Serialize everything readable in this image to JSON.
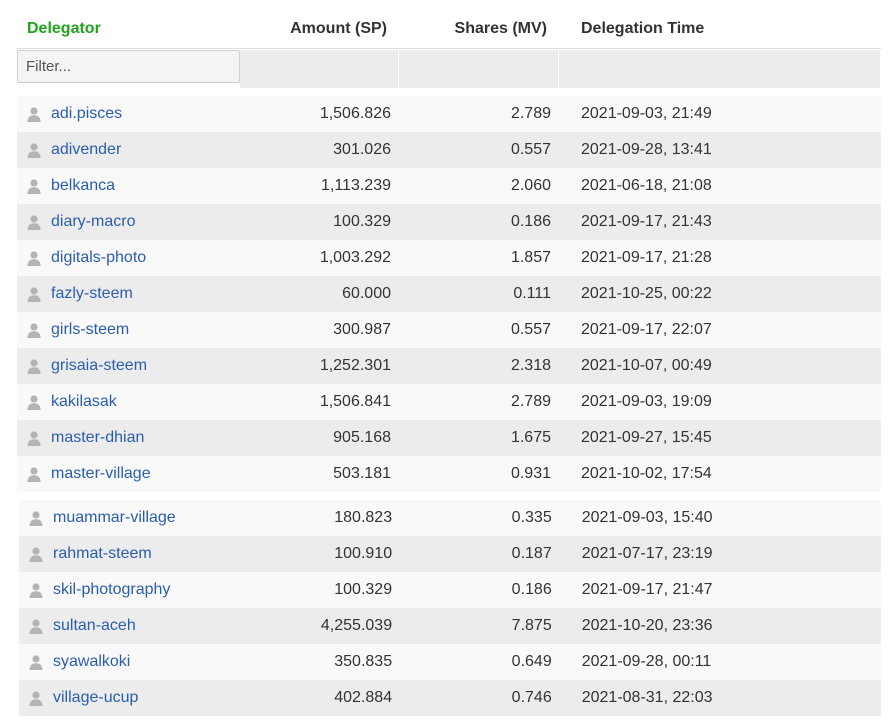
{
  "header": {
    "delegator": "Delegator",
    "amount": "Amount (SP)",
    "shares": "Shares (MV)",
    "time": "Delegation Time"
  },
  "filter": {
    "placeholder": "Filter..."
  },
  "colors": {
    "delegator_header": "#22a31f",
    "link": "#2a5db0",
    "row_light": "#f9f9f9",
    "row_dark": "#ececec"
  },
  "icons": {
    "user": "user-icon"
  },
  "rows_a": [
    {
      "delegator": "adi.pisces",
      "amount": "1,506.826",
      "shares": "2.789",
      "time": "2021-09-03, 21:49"
    },
    {
      "delegator": "adivender",
      "amount": "301.026",
      "shares": "0.557",
      "time": "2021-09-28, 13:41"
    },
    {
      "delegator": "belkanca",
      "amount": "1,113.239",
      "shares": "2.060",
      "time": "2021-06-18, 21:08"
    },
    {
      "delegator": "diary-macro",
      "amount": "100.329",
      "shares": "0.186",
      "time": "2021-09-17, 21:43"
    },
    {
      "delegator": "digitals-photo",
      "amount": "1,003.292",
      "shares": "1.857",
      "time": "2021-09-17, 21:28"
    },
    {
      "delegator": "fazly-steem",
      "amount": "60.000",
      "shares": "0.111",
      "time": "2021-10-25, 00:22"
    },
    {
      "delegator": "girls-steem",
      "amount": "300.987",
      "shares": "0.557",
      "time": "2021-09-17, 22:07"
    },
    {
      "delegator": "grisaia-steem",
      "amount": "1,252.301",
      "shares": "2.318",
      "time": "2021-10-07, 00:49"
    },
    {
      "delegator": "kakilasak",
      "amount": "1,506.841",
      "shares": "2.789",
      "time": "2021-09-03, 19:09"
    },
    {
      "delegator": "master-dhian",
      "amount": "905.168",
      "shares": "1.675",
      "time": "2021-09-27, 15:45"
    },
    {
      "delegator": "master-village",
      "amount": "503.181",
      "shares": "0.931",
      "time": "2021-10-02, 17:54"
    }
  ],
  "rows_b": [
    {
      "delegator": "muammar-village",
      "amount": "180.823",
      "shares": "0.335",
      "time": "2021-09-03, 15:40"
    },
    {
      "delegator": "rahmat-steem",
      "amount": "100.910",
      "shares": "0.187",
      "time": "2021-07-17, 23:19"
    },
    {
      "delegator": "skil-photography",
      "amount": "100.329",
      "shares": "0.186",
      "time": "2021-09-17, 21:47"
    },
    {
      "delegator": "sultan-aceh",
      "amount": "4,255.039",
      "shares": "7.875",
      "time": "2021-10-20, 23:36"
    },
    {
      "delegator": "syawalkoki",
      "amount": "350.835",
      "shares": "0.649",
      "time": "2021-09-28, 00:11"
    },
    {
      "delegator": "village-ucup",
      "amount": "402.884",
      "shares": "0.746",
      "time": "2021-08-31, 22:03"
    }
  ]
}
